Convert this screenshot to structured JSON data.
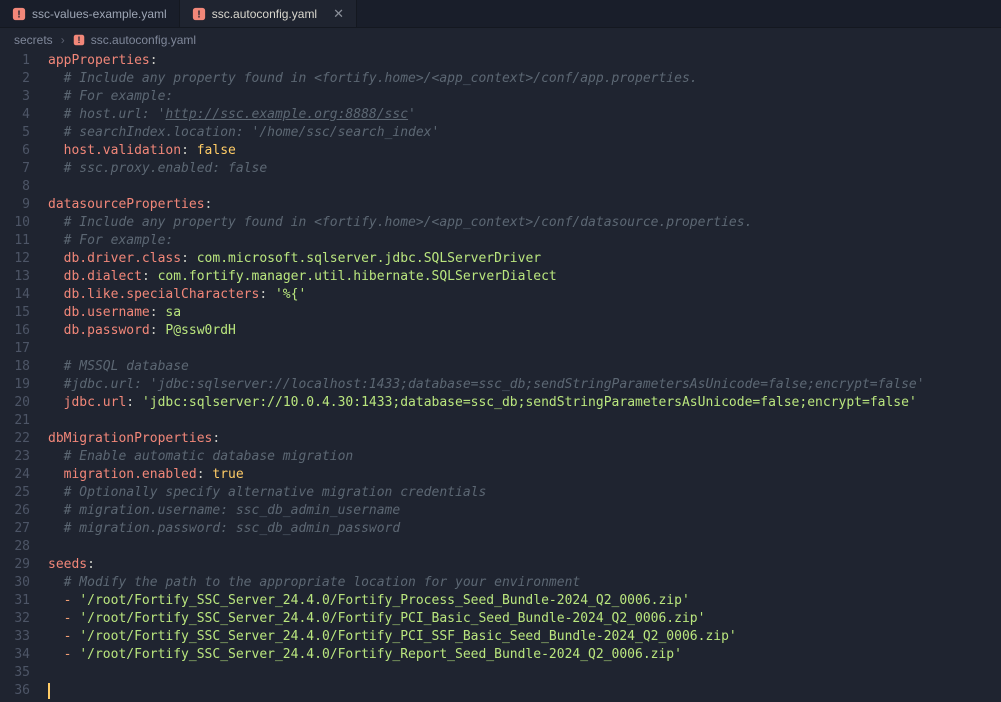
{
  "tabs": [
    {
      "label": "ssc-values-example.yaml",
      "active": false
    },
    {
      "label": "ssc.autoconfig.yaml",
      "active": true
    }
  ],
  "breadcrumbs": {
    "root": "secrets",
    "file": "ssc.autoconfig.yaml"
  },
  "lines": [
    [
      {
        "t": "key",
        "v": "appProperties"
      },
      {
        "t": "colon",
        "v": ":"
      }
    ],
    [
      {
        "t": "ind",
        "v": "  "
      },
      {
        "t": "comment",
        "v": "# Include any property found in <fortify.home>/<app_context>/conf/app.properties."
      }
    ],
    [
      {
        "t": "ind",
        "v": "  "
      },
      {
        "t": "comment",
        "v": "# For example:"
      }
    ],
    [
      {
        "t": "ind",
        "v": "  "
      },
      {
        "t": "comment",
        "v": "# host.url: '"
      },
      {
        "t": "commentlink",
        "v": "http://ssc.example.org:8888/ssc"
      },
      {
        "t": "comment",
        "v": "'"
      }
    ],
    [
      {
        "t": "ind",
        "v": "  "
      },
      {
        "t": "comment",
        "v": "# searchIndex.location: '/home/ssc/search_index'"
      }
    ],
    [
      {
        "t": "ind",
        "v": "  "
      },
      {
        "t": "key",
        "v": "host.validation"
      },
      {
        "t": "colon",
        "v": ": "
      },
      {
        "t": "bool",
        "v": "false"
      }
    ],
    [
      {
        "t": "ind",
        "v": "  "
      },
      {
        "t": "comment",
        "v": "# ssc.proxy.enabled: false"
      }
    ],
    [],
    [
      {
        "t": "key",
        "v": "datasourceProperties"
      },
      {
        "t": "colon",
        "v": ":"
      }
    ],
    [
      {
        "t": "ind",
        "v": "  "
      },
      {
        "t": "comment",
        "v": "# Include any property found in <fortify.home>/<app_context>/conf/datasource.properties."
      }
    ],
    [
      {
        "t": "ind",
        "v": "  "
      },
      {
        "t": "comment",
        "v": "# For example:"
      }
    ],
    [
      {
        "t": "ind",
        "v": "  "
      },
      {
        "t": "key",
        "v": "db.driver.class"
      },
      {
        "t": "colon",
        "v": ": "
      },
      {
        "t": "plain",
        "v": "com.microsoft.sqlserver.jdbc.SQLServerDriver"
      }
    ],
    [
      {
        "t": "ind",
        "v": "  "
      },
      {
        "t": "key",
        "v": "db.dialect"
      },
      {
        "t": "colon",
        "v": ": "
      },
      {
        "t": "plain",
        "v": "com.fortify.manager.util.hibernate.SQLServerDialect"
      }
    ],
    [
      {
        "t": "ind",
        "v": "  "
      },
      {
        "t": "key",
        "v": "db.like.specialCharacters"
      },
      {
        "t": "colon",
        "v": ": "
      },
      {
        "t": "string",
        "v": "'%{'"
      }
    ],
    [
      {
        "t": "ind",
        "v": "  "
      },
      {
        "t": "key",
        "v": "db.username"
      },
      {
        "t": "colon",
        "v": ": "
      },
      {
        "t": "plain",
        "v": "sa"
      }
    ],
    [
      {
        "t": "ind",
        "v": "  "
      },
      {
        "t": "key",
        "v": "db.password"
      },
      {
        "t": "colon",
        "v": ": "
      },
      {
        "t": "plain",
        "v": "P@ssw0rdH"
      }
    ],
    [],
    [
      {
        "t": "ind",
        "v": "  "
      },
      {
        "t": "comment",
        "v": "# MSSQL database"
      }
    ],
    [
      {
        "t": "ind",
        "v": "  "
      },
      {
        "t": "comment",
        "v": "#jdbc.url: 'jdbc:sqlserver://localhost:1433;database=ssc_db;sendStringParametersAsUnicode=false;encrypt=false'"
      }
    ],
    [
      {
        "t": "ind",
        "v": "  "
      },
      {
        "t": "key",
        "v": "jdbc.url"
      },
      {
        "t": "colon",
        "v": ": "
      },
      {
        "t": "string",
        "v": "'jdbc:sqlserver://10.0.4.30:1433;database=ssc_db;sendStringParametersAsUnicode=false;encrypt=false'"
      }
    ],
    [],
    [
      {
        "t": "key",
        "v": "dbMigrationProperties"
      },
      {
        "t": "colon",
        "v": ":"
      }
    ],
    [
      {
        "t": "ind",
        "v": "  "
      },
      {
        "t": "comment",
        "v": "# Enable automatic database migration"
      }
    ],
    [
      {
        "t": "ind",
        "v": "  "
      },
      {
        "t": "key",
        "v": "migration.enabled"
      },
      {
        "t": "colon",
        "v": ": "
      },
      {
        "t": "bool",
        "v": "true"
      }
    ],
    [
      {
        "t": "ind",
        "v": "  "
      },
      {
        "t": "comment",
        "v": "# Optionally specify alternative migration credentials"
      }
    ],
    [
      {
        "t": "ind",
        "v": "  "
      },
      {
        "t": "comment",
        "v": "# migration.username: ssc_db_admin_username"
      }
    ],
    [
      {
        "t": "ind",
        "v": "  "
      },
      {
        "t": "comment",
        "v": "# migration.password: ssc_db_admin_password"
      }
    ],
    [],
    [
      {
        "t": "key",
        "v": "seeds"
      },
      {
        "t": "colon",
        "v": ":"
      }
    ],
    [
      {
        "t": "ind",
        "v": "  "
      },
      {
        "t": "comment",
        "v": "# Modify the path to the appropriate location for your environment"
      }
    ],
    [
      {
        "t": "ind",
        "v": "  "
      },
      {
        "t": "dash",
        "v": "- "
      },
      {
        "t": "string",
        "v": "'/root/Fortify_SSC_Server_24.4.0/Fortify_Process_Seed_Bundle-2024_Q2_0006.zip'"
      }
    ],
    [
      {
        "t": "ind",
        "v": "  "
      },
      {
        "t": "dash",
        "v": "- "
      },
      {
        "t": "string",
        "v": "'/root/Fortify_SSC_Server_24.4.0/Fortify_PCI_Basic_Seed_Bundle-2024_Q2_0006.zip'"
      }
    ],
    [
      {
        "t": "ind",
        "v": "  "
      },
      {
        "t": "dash",
        "v": "- "
      },
      {
        "t": "string",
        "v": "'/root/Fortify_SSC_Server_24.4.0/Fortify_PCI_SSF_Basic_Seed_Bundle-2024_Q2_0006.zip'"
      }
    ],
    [
      {
        "t": "ind",
        "v": "  "
      },
      {
        "t": "dash",
        "v": "- "
      },
      {
        "t": "string",
        "v": "'/root/Fortify_SSC_Server_24.4.0/Fortify_Report_Seed_Bundle-2024_Q2_0006.zip'"
      }
    ],
    [],
    [
      {
        "t": "cursor",
        "v": ""
      }
    ]
  ]
}
